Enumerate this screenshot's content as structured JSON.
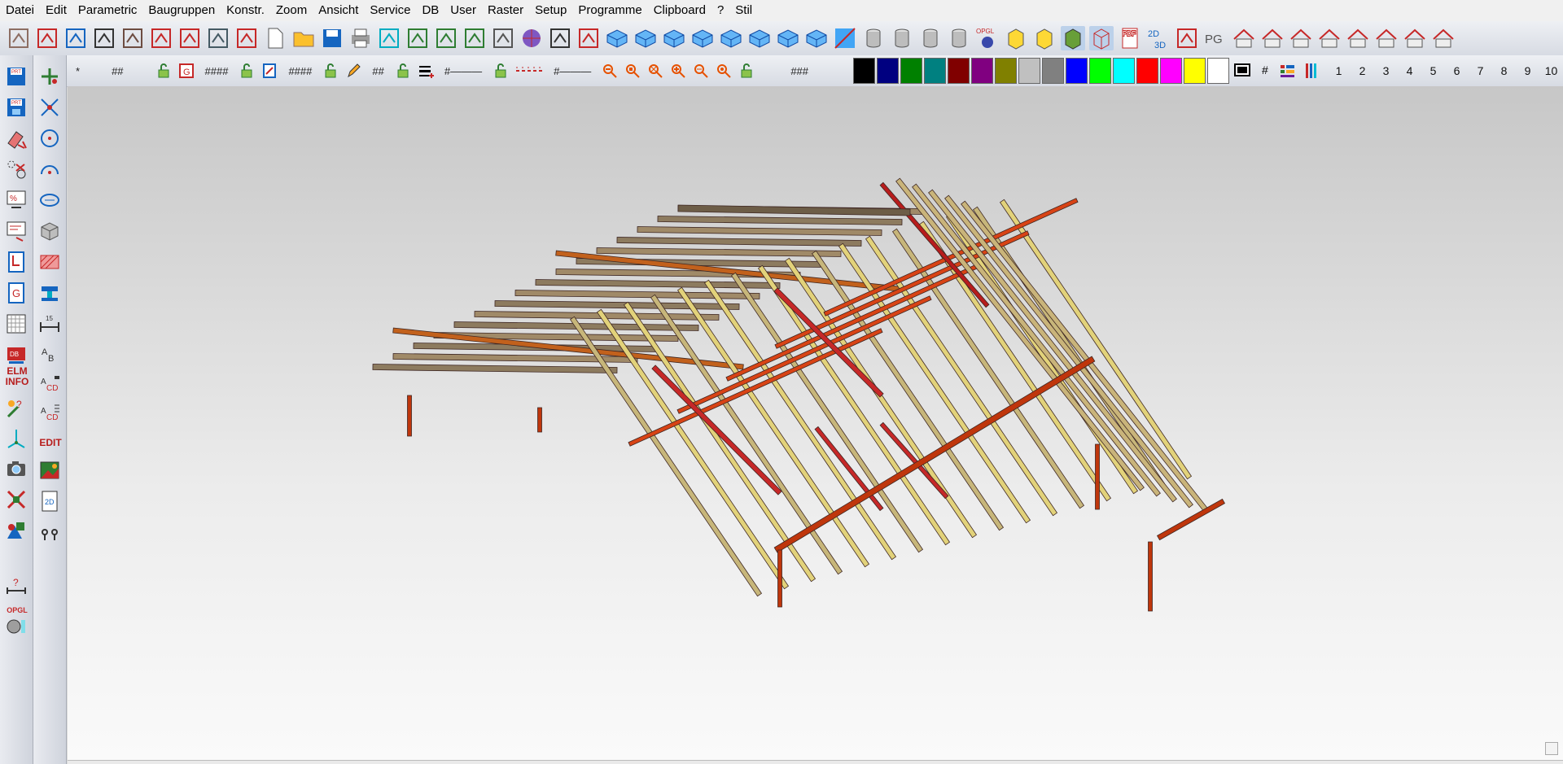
{
  "menu": [
    "Datei",
    "Edit",
    "Parametric",
    "Baugruppen",
    "Konstr.",
    "Zoom",
    "Ansicht",
    "Service",
    "DB",
    "User",
    "Raster",
    "Setup",
    "Programme",
    "Clipboard",
    "?",
    "Stil"
  ],
  "toolbar1": {
    "icons": [
      "roof-icon",
      "wall-panel-icon",
      "house-icon",
      "profile-icon",
      "window-icon",
      "funnel-icon",
      "stairs-icon",
      "beam-connector-icon",
      "roof-edit-icon",
      "new-document-icon",
      "open-folder-icon",
      "save-icon",
      "print-icon",
      "axis-icon",
      "axis-measure-icon",
      "axis-move-icon",
      "add-element-icon",
      "tools-icon",
      "globe-icon",
      "table-icon",
      "edit-frame-icon",
      "box-view-1-icon",
      "box-view-2-icon",
      "box-view-3-icon",
      "box-view-4-icon",
      "box-view-5-icon",
      "box-view-6-icon",
      "box-view-7-icon",
      "box-view-8-icon",
      "render-icon",
      "cylinder-1-icon",
      "cylinder-2-icon",
      "cylinder-3-icon",
      "cylinder-4-icon",
      "opgl-icon",
      "yellow-solid-icon",
      "yellow-solid-plus-icon",
      "green-solid-icon",
      "wireframe-box-icon",
      "pdf-icon",
      "2d-3d-icon",
      "help-tools-icon",
      "pg-icon",
      "roof-tool-1-icon",
      "roof-tool-2-icon",
      "roof-tool-3-icon",
      "roof-tool-4-icon",
      "roof-tool-5-icon",
      "roof-tool-6-icon",
      "roof-tool-7-icon",
      "roof-tool-8-icon"
    ],
    "opgl_label": "OPGL",
    "pdf_label": "PDF",
    "label_2d3d": "2D 3D",
    "pg_label": "PG"
  },
  "toolbar2": {
    "star": "*",
    "field1": "##",
    "field2": "####",
    "field3": "####",
    "field4": "##",
    "field5": "#———",
    "field6": "#———",
    "field7": "###",
    "hash": "#"
  },
  "colors": [
    "#000000",
    "#000080",
    "#008000",
    "#008080",
    "#800000",
    "#800080",
    "#808000",
    "#c0c0c0",
    "#808080",
    "#0000ff",
    "#00ff00",
    "#00ffff",
    "#ff0000",
    "#ff00ff",
    "#ffff00",
    "#ffffff"
  ],
  "layers": [
    "1",
    "2",
    "3",
    "4",
    "5",
    "6",
    "7",
    "8",
    "9",
    "10"
  ],
  "left1": {
    "elm": "ELM",
    "info": "INFO",
    "opgl": "OPGL"
  },
  "left2": {
    "edit": "EDIT",
    "dim": "15"
  },
  "model": {
    "name": "roof-timber-structure"
  }
}
